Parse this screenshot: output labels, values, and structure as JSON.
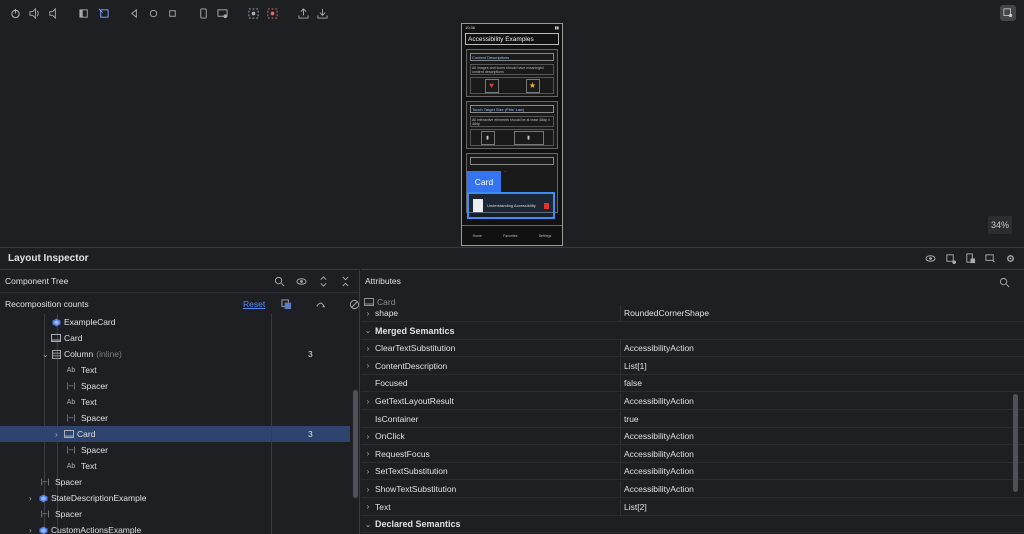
{
  "toolbar": {
    "icons": [
      "power-icon",
      "volume-up-icon",
      "volume-down-icon",
      "rotate-left-icon",
      "rotate-right-icon",
      "back-icon",
      "home-icon",
      "overview-icon",
      "fold-icon",
      "snapshot-icon",
      "screen-record-icon",
      "screenshot-icon",
      "export-icon",
      "download-icon"
    ]
  },
  "phone": {
    "status_time": "10:36",
    "app_title": "Accessibility Examples",
    "sections": [
      {
        "header": "Content Descriptions",
        "body": "All images and icons should have meaningful content descriptions",
        "items": [
          "Heart",
          "Favorite"
        ]
      },
      {
        "header": "Touch Target Size (Fitts' Law)",
        "body": "All interactive elements should be at least 48dp x 48dp",
        "items": [
          "Like",
          "Long press"
        ]
      },
      {
        "header": "",
        "body": "...",
        "items": []
      }
    ],
    "card_text": "Understanding Accessibility",
    "nav": [
      "Home",
      "Favorites",
      "Settings"
    ]
  },
  "card_tooltip": "Card",
  "zoom": "34%",
  "layout_inspector": {
    "title": "Layout Inspector"
  },
  "component_tree": {
    "title": "Component Tree",
    "recomposition_title": "Recomposition counts",
    "reset_label": "Reset",
    "rows": [
      {
        "label": "ExampleCard",
        "icon": "compose",
        "indent": 3,
        "count": ""
      },
      {
        "label": "Card",
        "icon": "card",
        "indent": 3,
        "count": ""
      },
      {
        "label": "Column",
        "extra": "(inline)",
        "icon": "column",
        "indent": 3,
        "expanded": true,
        "count": "3"
      },
      {
        "label": "Text",
        "icon": "text",
        "indent": 4,
        "count": ""
      },
      {
        "label": "Spacer",
        "icon": "spacer",
        "indent": 4,
        "count": ""
      },
      {
        "label": "Text",
        "icon": "text",
        "indent": 4,
        "count": ""
      },
      {
        "label": "Spacer",
        "icon": "spacer",
        "indent": 4,
        "count": ""
      },
      {
        "label": "Card",
        "icon": "card",
        "indent": 4,
        "collapsed": true,
        "selected": true,
        "count": "3"
      },
      {
        "label": "Spacer",
        "icon": "spacer",
        "indent": 4,
        "count": ""
      },
      {
        "label": "Text",
        "icon": "text",
        "indent": 4,
        "count": ""
      },
      {
        "label": "Spacer",
        "icon": "spacer",
        "indent": 2,
        "count": ""
      },
      {
        "label": "StateDescriptionExample",
        "icon": "compose",
        "indent": 2,
        "collapsed": true,
        "count": ""
      },
      {
        "label": "Spacer",
        "icon": "spacer",
        "indent": 2,
        "count": ""
      },
      {
        "label": "CustomActionsExample",
        "icon": "compose",
        "indent": 2,
        "collapsed": true,
        "count": ""
      }
    ]
  },
  "attributes": {
    "title": "Attributes",
    "subtitle": "Card",
    "rows": [
      {
        "name": "shape",
        "value": "RoundedCornerShape",
        "chevron": true
      },
      {
        "name": "Merged Semantics",
        "group": true
      },
      {
        "name": "ClearTextSubstitution",
        "value": "AccessibilityAction",
        "chevron": true
      },
      {
        "name": "ContentDescription",
        "value": "List[1]",
        "chevron": true
      },
      {
        "name": "Focused",
        "value": "false",
        "chevron": false
      },
      {
        "name": "GetTextLayoutResult",
        "value": "AccessibilityAction",
        "chevron": true
      },
      {
        "name": "IsContainer",
        "value": "true",
        "chevron": false
      },
      {
        "name": "OnClick",
        "value": "AccessibilityAction",
        "chevron": true
      },
      {
        "name": "RequestFocus",
        "value": "AccessibilityAction",
        "chevron": true
      },
      {
        "name": "SetTextSubstitution",
        "value": "AccessibilityAction",
        "chevron": true
      },
      {
        "name": "ShowTextSubstitution",
        "value": "AccessibilityAction",
        "chevron": true
      },
      {
        "name": "Text",
        "value": "List[2]",
        "chevron": true
      },
      {
        "name": "Declared Semantics",
        "group": true
      }
    ]
  },
  "colors": {
    "accent": "#3574f0",
    "selection": "#2e436e",
    "background": "#1e1f22"
  }
}
